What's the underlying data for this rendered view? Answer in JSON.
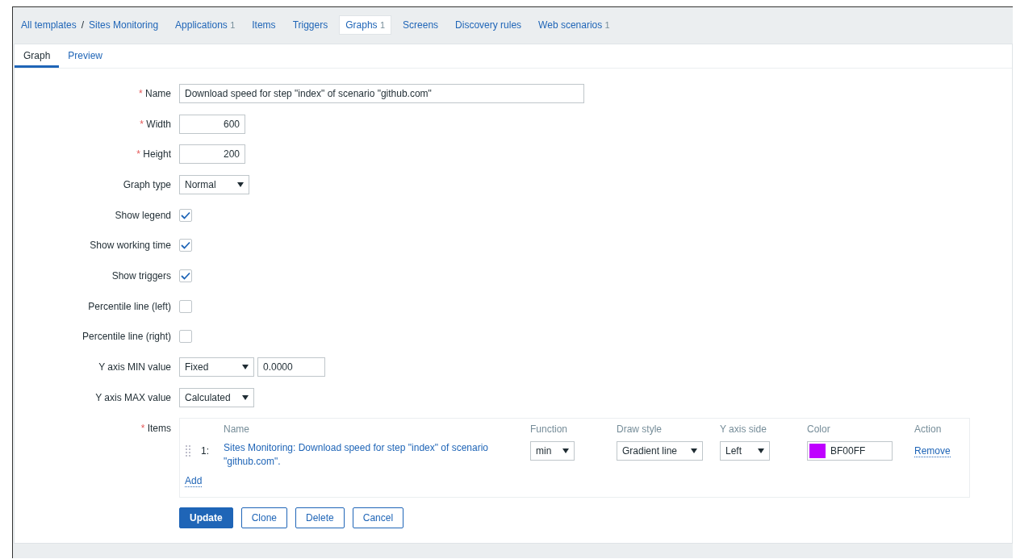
{
  "breadcrumbs": {
    "items": [
      {
        "label": "All templates"
      },
      {
        "label": "Sites Monitoring"
      }
    ],
    "separator": "/"
  },
  "nav_tabs": [
    {
      "label": "Applications",
      "count": "1",
      "selected": false
    },
    {
      "label": "Items",
      "selected": false
    },
    {
      "label": "Triggers",
      "selected": false
    },
    {
      "label": "Graphs",
      "count": "1",
      "selected": true
    },
    {
      "label": "Screens",
      "selected": false
    },
    {
      "label": "Discovery rules",
      "selected": false
    },
    {
      "label": "Web scenarios",
      "count": "1",
      "selected": false
    }
  ],
  "sub_tabs": [
    {
      "label": "Graph",
      "selected": true
    },
    {
      "label": "Preview",
      "selected": false
    }
  ],
  "form": {
    "fields": [
      {
        "kind": "text",
        "label": "Name",
        "required": true,
        "value": "Download speed for step \"index\" of scenario \"github.com\""
      },
      {
        "kind": "number",
        "label": "Width",
        "required": true,
        "value": "600"
      },
      {
        "kind": "number",
        "label": "Height",
        "required": true,
        "value": "200"
      },
      {
        "kind": "select",
        "label": "Graph type",
        "required": false,
        "value": "Normal"
      },
      {
        "kind": "checkbox",
        "label": "Show legend",
        "required": false,
        "checked": true
      },
      {
        "kind": "checkbox",
        "label": "Show working time",
        "required": false,
        "checked": true
      },
      {
        "kind": "checkbox",
        "label": "Show triggers",
        "required": false,
        "checked": true
      },
      {
        "kind": "checkbox",
        "label": "Percentile line (left)",
        "required": false,
        "checked": false
      },
      {
        "kind": "checkbox",
        "label": "Percentile line (right)",
        "required": false,
        "checked": false
      },
      {
        "kind": "select_value",
        "label": "Y axis MIN value",
        "required": false,
        "value": "Fixed",
        "input": "0.0000"
      },
      {
        "kind": "select",
        "label": "Y axis MAX value",
        "required": false,
        "value": "Calculated"
      },
      {
        "kind": "items",
        "label": "Items",
        "required": true
      }
    ],
    "required_mark": "*",
    "items": {
      "columns": [
        "Name",
        "Function",
        "Draw style",
        "Y axis side",
        "Color",
        "Action"
      ],
      "rows": [
        {
          "number": "1:",
          "name": "Sites Monitoring: Download speed for step \"index\" of scenario \"github.com\".",
          "function": "min",
          "draw_style": "Gradient line",
          "y_axis_side": "Left",
          "color": "#bf00ff",
          "color_code": "BF00FF",
          "action": "Remove"
        }
      ],
      "add": "Add"
    }
  },
  "buttons": [
    {
      "label": "Update",
      "primary": true
    },
    {
      "label": "Clone",
      "primary": false
    },
    {
      "label": "Delete",
      "primary": false
    },
    {
      "label": "Cancel",
      "primary": false
    }
  ]
}
